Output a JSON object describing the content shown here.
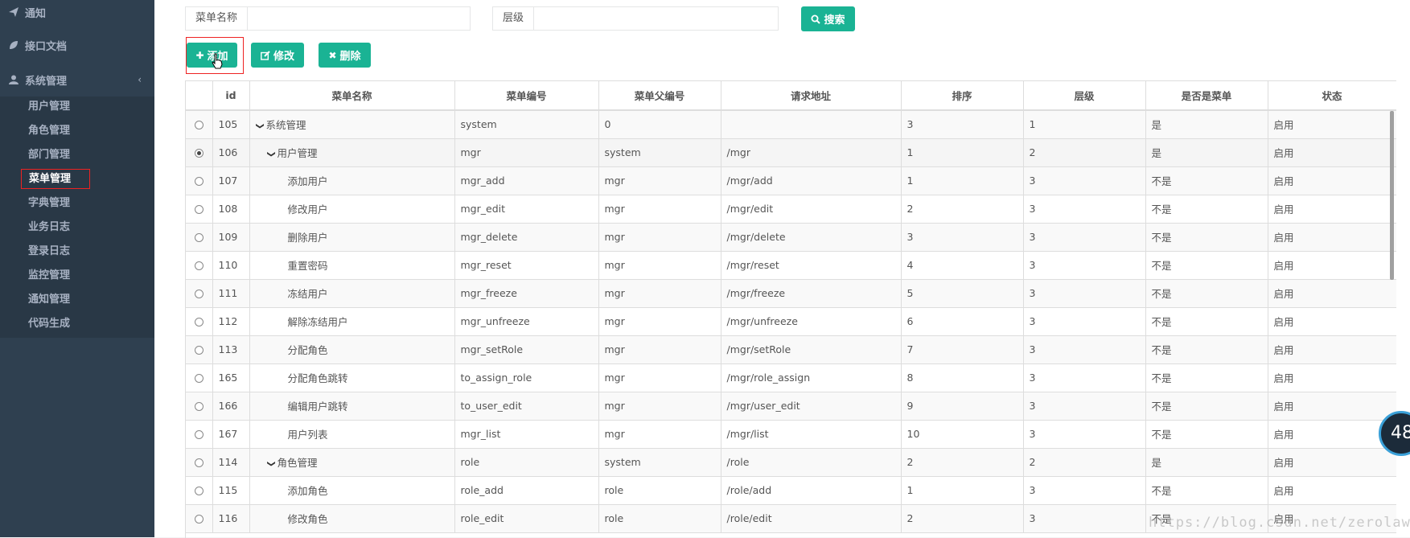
{
  "sidebar": {
    "top_items": [
      {
        "label": "通知",
        "icon": "paper-plane-icon"
      },
      {
        "label": "接口文档",
        "icon": "leaf-icon"
      },
      {
        "label": "系统管理",
        "icon": "user-icon",
        "chevron": "‹"
      }
    ],
    "sub_items": [
      "用户管理",
      "角色管理",
      "部门管理",
      "菜单管理",
      "字典管理",
      "业务日志",
      "登录日志",
      "监控管理",
      "通知管理",
      "代码生成"
    ],
    "active_index": 3
  },
  "search": {
    "menu_name_label": "菜单名称",
    "menu_name_value": "",
    "level_label": "层级",
    "level_value": "",
    "search_button": "搜索"
  },
  "toolbar": {
    "add": "添加",
    "edit": "修改",
    "delete": "删除"
  },
  "table": {
    "headers": [
      "id",
      "菜单名称",
      "菜单编号",
      "菜单父编号",
      "请求地址",
      "排序",
      "层级",
      "是否是菜单",
      "状态"
    ],
    "rows": [
      {
        "id": "105",
        "name": "系统管理",
        "code": "system",
        "pcode": "0",
        "url": "",
        "num": "3",
        "levels": "1",
        "ismenu": "是",
        "status": "启用",
        "indent": 0,
        "expanded": true,
        "selected": false
      },
      {
        "id": "106",
        "name": "用户管理",
        "code": "mgr",
        "pcode": "system",
        "url": "/mgr",
        "num": "1",
        "levels": "2",
        "ismenu": "是",
        "status": "启用",
        "indent": 1,
        "expanded": true,
        "selected": true
      },
      {
        "id": "107",
        "name": "添加用户",
        "code": "mgr_add",
        "pcode": "mgr",
        "url": "/mgr/add",
        "num": "1",
        "levels": "3",
        "ismenu": "不是",
        "status": "启用",
        "indent": 2,
        "expanded": false,
        "selected": false
      },
      {
        "id": "108",
        "name": "修改用户",
        "code": "mgr_edit",
        "pcode": "mgr",
        "url": "/mgr/edit",
        "num": "2",
        "levels": "3",
        "ismenu": "不是",
        "status": "启用",
        "indent": 2,
        "expanded": false,
        "selected": false
      },
      {
        "id": "109",
        "name": "删除用户",
        "code": "mgr_delete",
        "pcode": "mgr",
        "url": "/mgr/delete",
        "num": "3",
        "levels": "3",
        "ismenu": "不是",
        "status": "启用",
        "indent": 2,
        "expanded": false,
        "selected": false
      },
      {
        "id": "110",
        "name": "重置密码",
        "code": "mgr_reset",
        "pcode": "mgr",
        "url": "/mgr/reset",
        "num": "4",
        "levels": "3",
        "ismenu": "不是",
        "status": "启用",
        "indent": 2,
        "expanded": false,
        "selected": false
      },
      {
        "id": "111",
        "name": "冻结用户",
        "code": "mgr_freeze",
        "pcode": "mgr",
        "url": "/mgr/freeze",
        "num": "5",
        "levels": "3",
        "ismenu": "不是",
        "status": "启用",
        "indent": 2,
        "expanded": false,
        "selected": false
      },
      {
        "id": "112",
        "name": "解除冻结用户",
        "code": "mgr_unfreeze",
        "pcode": "mgr",
        "url": "/mgr/unfreeze",
        "num": "6",
        "levels": "3",
        "ismenu": "不是",
        "status": "启用",
        "indent": 2,
        "expanded": false,
        "selected": false
      },
      {
        "id": "113",
        "name": "分配角色",
        "code": "mgr_setRole",
        "pcode": "mgr",
        "url": "/mgr/setRole",
        "num": "7",
        "levels": "3",
        "ismenu": "不是",
        "status": "启用",
        "indent": 2,
        "expanded": false,
        "selected": false
      },
      {
        "id": "165",
        "name": "分配角色跳转",
        "code": "to_assign_role",
        "pcode": "mgr",
        "url": "/mgr/role_assign",
        "num": "8",
        "levels": "3",
        "ismenu": "不是",
        "status": "启用",
        "indent": 2,
        "expanded": false,
        "selected": false
      },
      {
        "id": "166",
        "name": "编辑用户跳转",
        "code": "to_user_edit",
        "pcode": "mgr",
        "url": "/mgr/user_edit",
        "num": "9",
        "levels": "3",
        "ismenu": "不是",
        "status": "启用",
        "indent": 2,
        "expanded": false,
        "selected": false
      },
      {
        "id": "167",
        "name": "用户列表",
        "code": "mgr_list",
        "pcode": "mgr",
        "url": "/mgr/list",
        "num": "10",
        "levels": "3",
        "ismenu": "不是",
        "status": "启用",
        "indent": 2,
        "expanded": false,
        "selected": false
      },
      {
        "id": "114",
        "name": "角色管理",
        "code": "role",
        "pcode": "system",
        "url": "/role",
        "num": "2",
        "levels": "2",
        "ismenu": "是",
        "status": "启用",
        "indent": 1,
        "expanded": true,
        "selected": false
      },
      {
        "id": "115",
        "name": "添加角色",
        "code": "role_add",
        "pcode": "role",
        "url": "/role/add",
        "num": "1",
        "levels": "3",
        "ismenu": "不是",
        "status": "启用",
        "indent": 2,
        "expanded": false,
        "selected": false
      },
      {
        "id": "116",
        "name": "修改角色",
        "code": "role_edit",
        "pcode": "role",
        "url": "/role/edit",
        "num": "2",
        "levels": "3",
        "ismenu": "不是",
        "status": "启用",
        "indent": 2,
        "expanded": false,
        "selected": false
      }
    ]
  },
  "badge": "48",
  "watermark": "https://blog.csdn.net/zerolaw"
}
